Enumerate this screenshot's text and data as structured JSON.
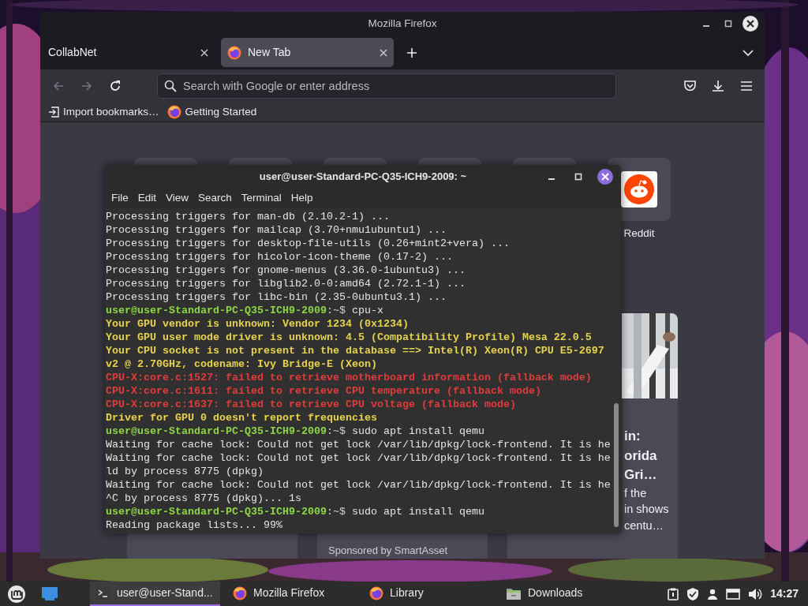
{
  "firefox": {
    "title": "Mozilla Firefox",
    "tabs": [
      {
        "label": "CollabNet",
        "selected": false,
        "kind": "plain"
      },
      {
        "label": "New Tab",
        "selected": true,
        "kind": "firefox"
      }
    ],
    "address_bar": {
      "placeholder": "Search with Google or enter address"
    },
    "bookmarks": [
      {
        "label": "Import bookmarks…",
        "kind": "import"
      },
      {
        "label": "Getting Started",
        "kind": "firefox"
      }
    ],
    "shortcuts": [
      {
        "label": "Reddit"
      }
    ],
    "story": {
      "headline": [
        "in:",
        "orida",
        "Gri…"
      ],
      "excerpt": [
        "f the",
        "in shows",
        "centu…"
      ]
    },
    "sponsor": "Sponsored by SmartAsset"
  },
  "terminal": {
    "title": "user@user-Standard-PC-Q35-ICH9-2009: ~",
    "menu": [
      "File",
      "Edit",
      "View",
      "Search",
      "Terminal",
      "Help"
    ],
    "lines": [
      {
        "kind": "plain",
        "text": "Processing triggers for man-db (2.10.2-1) ..."
      },
      {
        "kind": "plain",
        "text": "Processing triggers for mailcap (3.70+nmu1ubuntu1) ..."
      },
      {
        "kind": "plain",
        "text": "Processing triggers for desktop-file-utils (0.26+mint2+vera) ..."
      },
      {
        "kind": "plain",
        "text": "Processing triggers for hicolor-icon-theme (0.17-2) ..."
      },
      {
        "kind": "plain",
        "text": "Processing triggers for gnome-menus (3.36.0-1ubuntu3) ..."
      },
      {
        "kind": "plain",
        "text": "Processing triggers for libglib2.0-0:amd64 (2.72.1-1) ..."
      },
      {
        "kind": "plain",
        "text": "Processing triggers for libc-bin (2.35-0ubuntu3.1) ..."
      },
      {
        "kind": "prompt",
        "user_host": "user@user-Standard-PC-Q35-ICH9-2009",
        "cwd": ":~$",
        "text": "cpu-x"
      },
      {
        "kind": "warning",
        "text": "Your GPU vendor is unknown: Vendor 1234 (0x1234)"
      },
      {
        "kind": "warning",
        "text": "Your GPU user mode driver is unknown: 4.5 (Compatibility Profile) Mesa 22.0.5"
      },
      {
        "kind": "warning",
        "text": "Your CPU socket is not present in the database ==> Intel(R) Xeon(R) CPU E5-2697"
      },
      {
        "kind": "warning",
        "text": "v2 @ 2.70GHz, codename: Ivy Bridge-E (Xeon)"
      },
      {
        "kind": "error",
        "text": "CPU-X:core.c:1527: failed to retrieve motherboard information (fallback mode)"
      },
      {
        "kind": "error",
        "text": "CPU-X:core.c:1611: failed to retrieve CPU temperature (fallback mode)"
      },
      {
        "kind": "error",
        "text": "CPU-X:core.c:1637: failed to retrieve CPU voltage (fallback mode)"
      },
      {
        "kind": "warning",
        "text": "Driver for GPU 0 doesn't report frequencies"
      },
      {
        "kind": "prompt",
        "user_host": "user@user-Standard-PC-Q35-ICH9-2009",
        "cwd": ":~$",
        "text": "sudo apt install qemu"
      },
      {
        "kind": "plain",
        "text": "Waiting for cache lock: Could not get lock /var/lib/dpkg/lock-frontend. It is he"
      },
      {
        "kind": "plain",
        "text": "Waiting for cache lock: Could not get lock /var/lib/dpkg/lock-frontend. It is he"
      },
      {
        "kind": "plain",
        "text": "ld by process 8775 (dpkg)"
      },
      {
        "kind": "plain",
        "text": "Waiting for cache lock: Could not get lock /var/lib/dpkg/lock-frontend. It is he"
      },
      {
        "kind": "plain",
        "text": "^C by process 8775 (dpkg)... 1s"
      },
      {
        "kind": "prompt",
        "user_host": "user@user-Standard-PC-Q35-ICH9-2009",
        "cwd": ":~$",
        "text": "sudo apt install qemu"
      },
      {
        "kind": "plain",
        "text": "Reading package lists... 99%"
      }
    ]
  },
  "taskbar": {
    "tasks": [
      {
        "label": "user@user-Stand...",
        "kind": "terminal",
        "selected": true
      },
      {
        "label": "Mozilla Firefox",
        "kind": "firefox",
        "selected": false
      },
      {
        "label": "Library",
        "kind": "firefox",
        "selected": false
      },
      {
        "label": "Downloads",
        "kind": "folder",
        "selected": false
      }
    ],
    "clock": "14:27"
  }
}
